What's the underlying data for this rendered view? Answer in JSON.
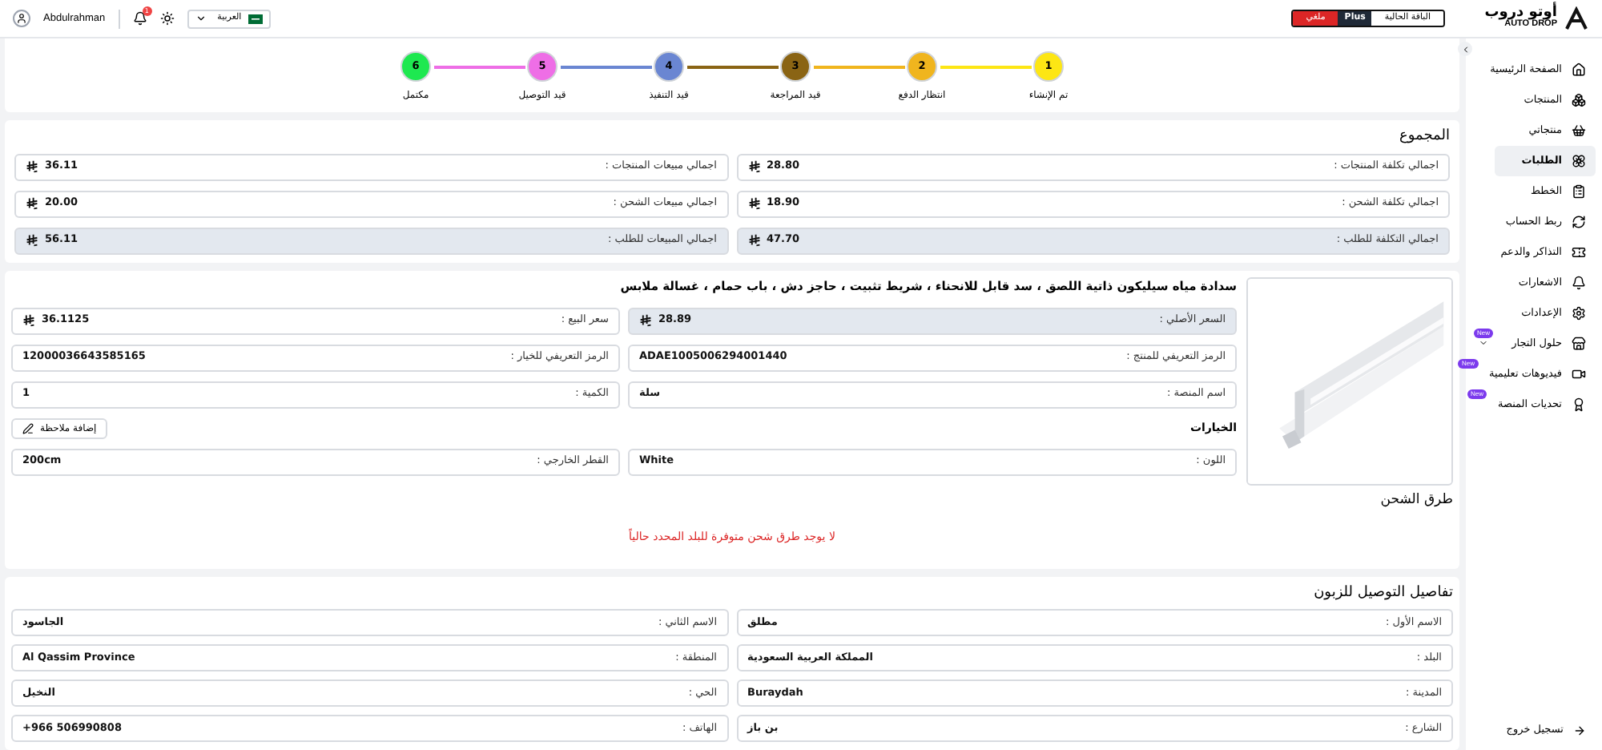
{
  "header": {
    "logo": {
      "arabic": "أوتو دروب",
      "latin": "AUTO DROP"
    },
    "plan": {
      "label": "الباقة الحالية",
      "name": "Plus",
      "status": "ملغي"
    },
    "language": "العربية",
    "notifications": "1",
    "user": "Abdulrahman"
  },
  "sidebar": {
    "items": [
      {
        "label": "الصفحة الرئيسية",
        "selected": false,
        "kind": "link"
      },
      {
        "label": "المنتجات",
        "selected": false,
        "kind": "link"
      },
      {
        "label": "منتجاتي",
        "selected": false,
        "kind": "link"
      },
      {
        "label": "الطلبات",
        "selected": true,
        "kind": "link"
      },
      {
        "label": "الخطط",
        "selected": false,
        "kind": "link"
      },
      {
        "label": "ربط الحساب",
        "selected": false,
        "kind": "link"
      },
      {
        "label": "التذاكر والدعم",
        "selected": false,
        "kind": "link"
      },
      {
        "label": "الاشعارات",
        "selected": false,
        "kind": "link"
      },
      {
        "label": "الإعدادات",
        "selected": false,
        "kind": "link"
      },
      {
        "label": "حلول التجار",
        "selected": false,
        "kind": "group",
        "badge": "New"
      },
      {
        "label": "فيديوهات تعليمية",
        "selected": false,
        "kind": "link",
        "badge": "New"
      },
      {
        "label": "تحديات المنصة",
        "selected": false,
        "kind": "link",
        "badge": "New"
      }
    ],
    "logout": "تسجيل خروج"
  },
  "steps": [
    {
      "number": "1",
      "label": "تم الإنشاء",
      "color": "#fde614"
    },
    {
      "number": "2",
      "label": "انتظار الدفع",
      "color": "#f0b51e"
    },
    {
      "number": "3",
      "label": "قيد المراجعة",
      "color": "#8a6414"
    },
    {
      "number": "4",
      "label": "قيد التنفيذ",
      "color": "#6a86d2"
    },
    {
      "number": "5",
      "label": "قيد التوصيل",
      "color": "#ee6ee6"
    },
    {
      "number": "6",
      "label": "مكتمل",
      "color": "#1ee850"
    }
  ],
  "summary": {
    "title": "المجموع",
    "rows": [
      {
        "label": "اجمالي تكلفة المنتجات :",
        "value": "28.80",
        "highlighted": false
      },
      {
        "label": "اجمالي مبيعات المنتجات :",
        "value": "36.11",
        "highlighted": false
      },
      {
        "label": "اجمالي تكلفة الشحن :",
        "value": "18.90",
        "highlighted": false
      },
      {
        "label": "اجمالي مبيعات الشحن :",
        "value": "20.00",
        "highlighted": false
      },
      {
        "label": "اجمالي التكلفة للطلب :",
        "value": "47.70",
        "highlighted": true
      },
      {
        "label": "اجمالي المبيعات للطلب :",
        "value": "56.11",
        "highlighted": true
      }
    ]
  },
  "product": {
    "title": "سدادة مياه سيليكون ذاتية اللصق ، سد قابل للانحناء ، شريط تثبيت ، حاجز دش ، باب حمام ، غسالة ملابس",
    "fields": [
      {
        "label": "السعر الأصلي :",
        "value": "28.89",
        "currency": true,
        "highlighted": true
      },
      {
        "label": "سعر البيع :",
        "value": "36.1125",
        "currency": true,
        "highlighted": false
      },
      {
        "label": "الرمز التعريفي للمنتج :",
        "value": "ADAE1005006294001440",
        "currency": false,
        "highlighted": false
      },
      {
        "label": "الرمز التعريفي للخيار :",
        "value": "12000036643585165",
        "currency": false,
        "highlighted": false
      },
      {
        "label": "اسم المنصة :",
        "value": "سلة",
        "currency": false,
        "highlighted": false
      },
      {
        "label": "الكمية :",
        "value": "1",
        "currency": false,
        "highlighted": false
      }
    ],
    "options_title": "الخيارات",
    "add_note": "إضافة ملاحظة",
    "options": [
      {
        "label": "اللون :",
        "value": "White"
      },
      {
        "label": "القطر الخارجي :",
        "value": "200cm"
      }
    ]
  },
  "shipping": {
    "title": "طرق الشحن",
    "message": "لا يوجد طرق شحن متوفرة للبلد المحدد حالياً"
  },
  "customer": {
    "title": "تفاصيل التوصيل للزبون",
    "fields": [
      {
        "label": "الاسم الأول :",
        "value": "مطلق"
      },
      {
        "label": "الاسم الثاني :",
        "value": "الجاسود"
      },
      {
        "label": "البلد :",
        "value": "المملكة العربية السعودية"
      },
      {
        "label": "المنطقة :",
        "value": "Al Qassim Province"
      },
      {
        "label": "المدينة :",
        "value": "Buraydah"
      },
      {
        "label": "الحي :",
        "value": "النخيل"
      },
      {
        "label": "الشارع :",
        "value": "بن باز"
      },
      {
        "label": "الهاتف :",
        "value": "+966 506990808"
      }
    ]
  }
}
